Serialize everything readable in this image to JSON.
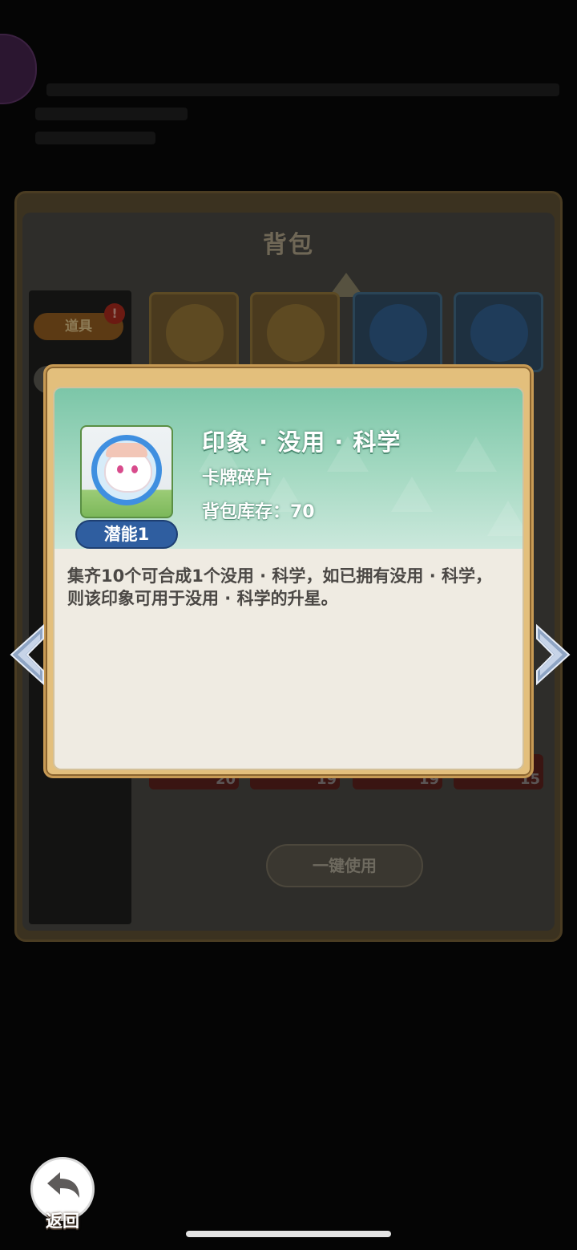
{
  "background": {
    "panel_title": "背包",
    "sidebar": {
      "tab_label": "道具",
      "tab_badge": "!"
    },
    "grid_counts": [
      "20",
      "19",
      "19",
      "15"
    ],
    "one_key_use_label": "一键使用"
  },
  "item_detail": {
    "name": "印象 · 没用 · 科学",
    "type": "卡牌碎片",
    "stock_label": "背包库存：70",
    "potential_tag": "潜能1",
    "description": "集齐10个可合成1个没用 · 科学，如已拥有没用 · 科学，则该印象可用于没用 · 科学的升星。"
  },
  "controls": {
    "back_label": "返回"
  },
  "icons": [
    "chevron-left-icon",
    "chevron-right-icon",
    "back-arrow-icon",
    "up-arrow-icon"
  ],
  "colors": {
    "modal_border": "#e3bf7c",
    "header_green": "#7cc6a8",
    "potential_tag": "#2f5ea0"
  }
}
